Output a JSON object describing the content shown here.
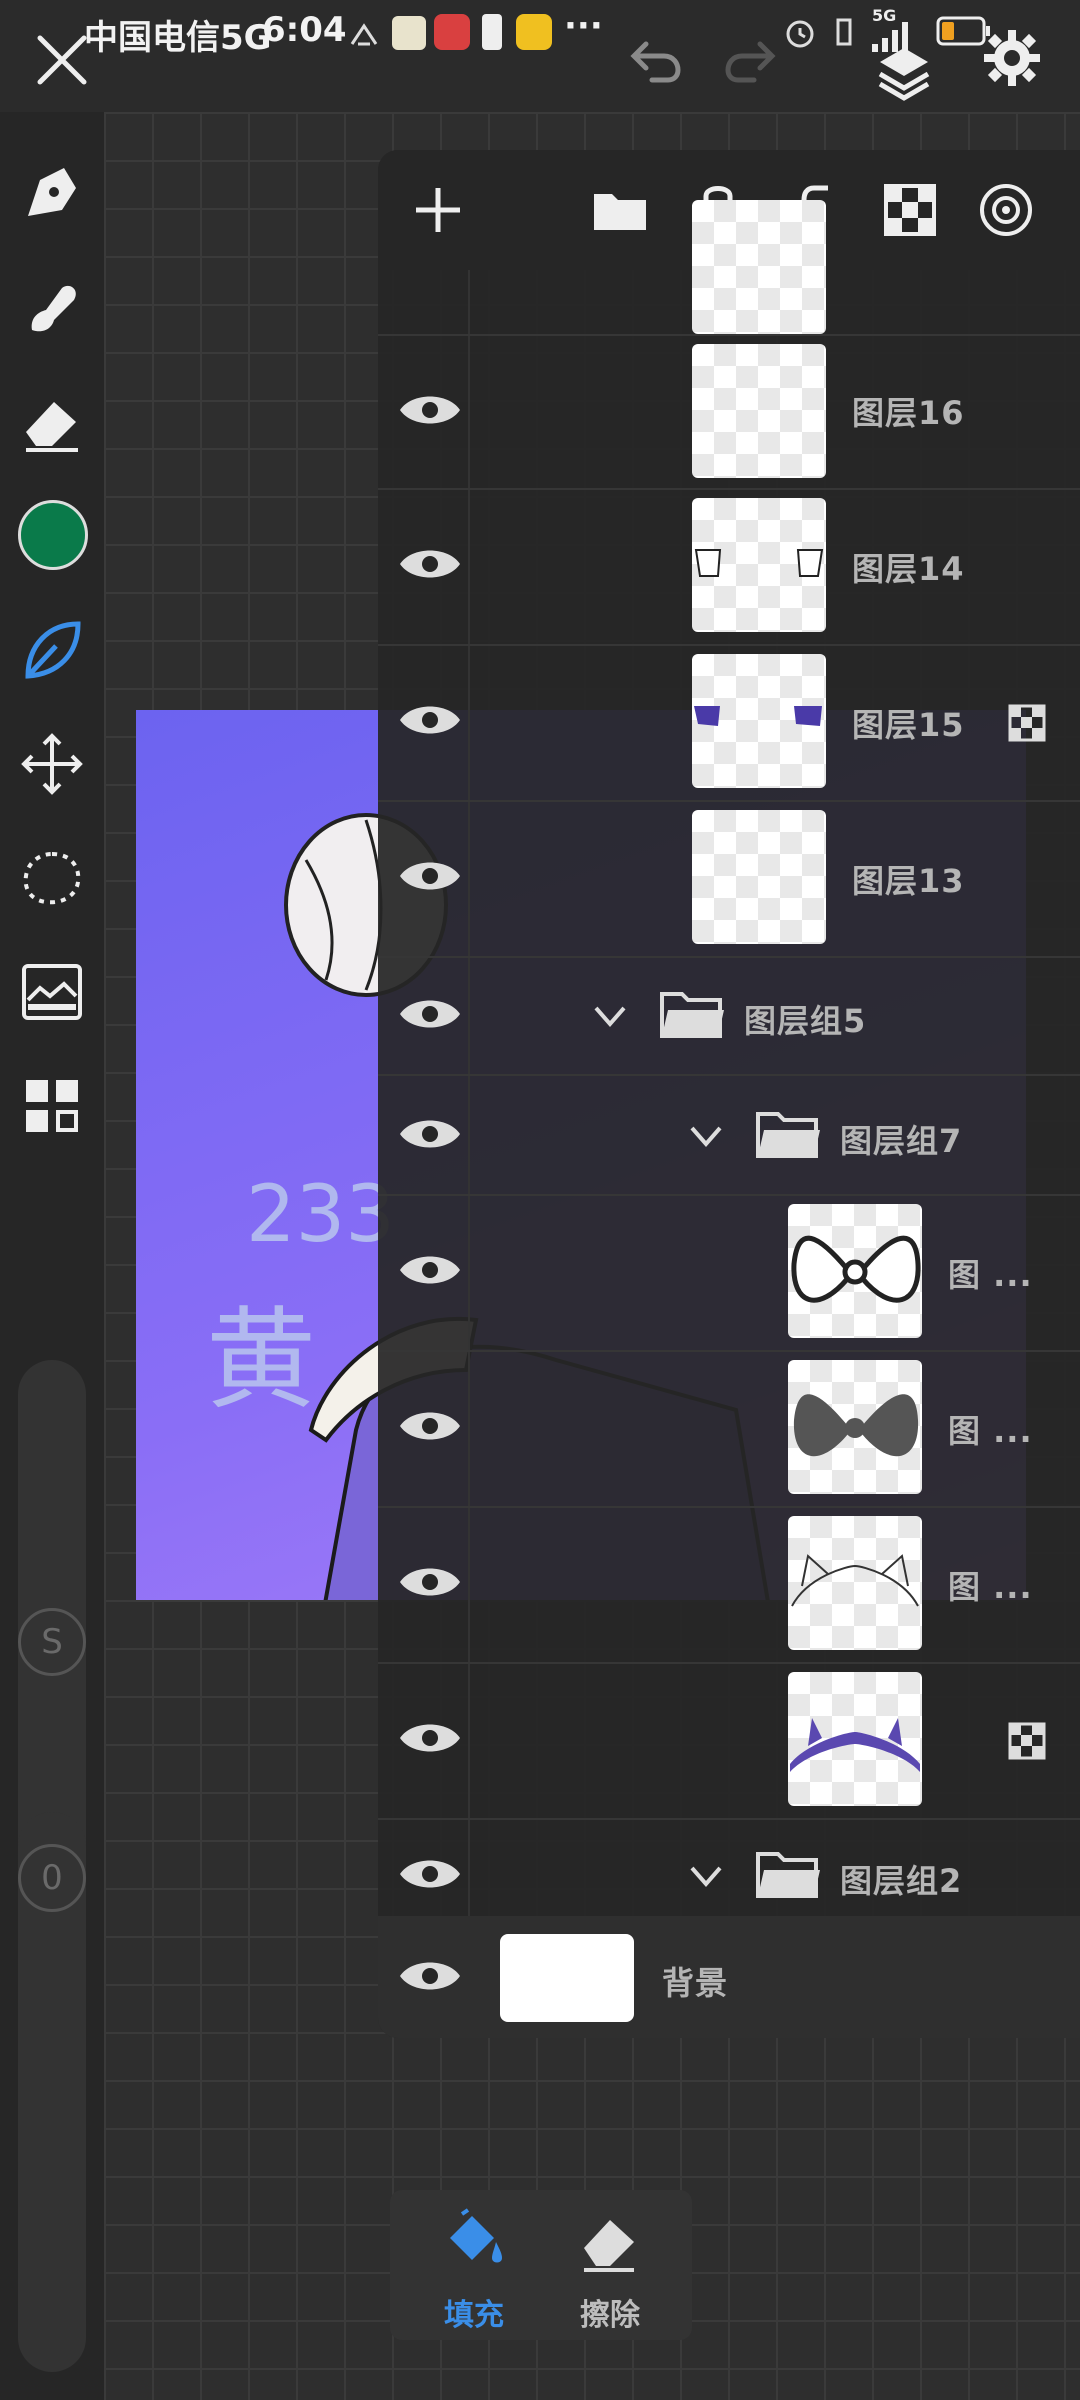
{
  "status_bar": {
    "carrier": "中国电信5G",
    "time": "6:04",
    "more": "···",
    "network": "5G"
  },
  "colors": {
    "current_color": "#0a7a4a",
    "accent": "#3a8ee8",
    "canvas_gradient_top": "#6c63f0",
    "canvas_gradient_bottom": "#a57ef8"
  },
  "artwork": {
    "text_line1": "233",
    "text_line2": "黄"
  },
  "layers": [
    {
      "label": "图层16"
    },
    {
      "label": "图层14"
    },
    {
      "label": "图层15"
    },
    {
      "label": "图层13"
    },
    {
      "label": "图层组5"
    },
    {
      "label": "图层组7"
    },
    {
      "label": "图 ..."
    },
    {
      "label": "图 ..."
    },
    {
      "label": "图 ..."
    },
    {
      "label": ""
    },
    {
      "label": "图层组2"
    }
  ],
  "background_layer": {
    "label": "背景"
  },
  "sliders": {
    "size_label": "S",
    "opacity_value": "0"
  },
  "bottom_tools": {
    "fill_label": "填充",
    "erase_label": "擦除"
  }
}
